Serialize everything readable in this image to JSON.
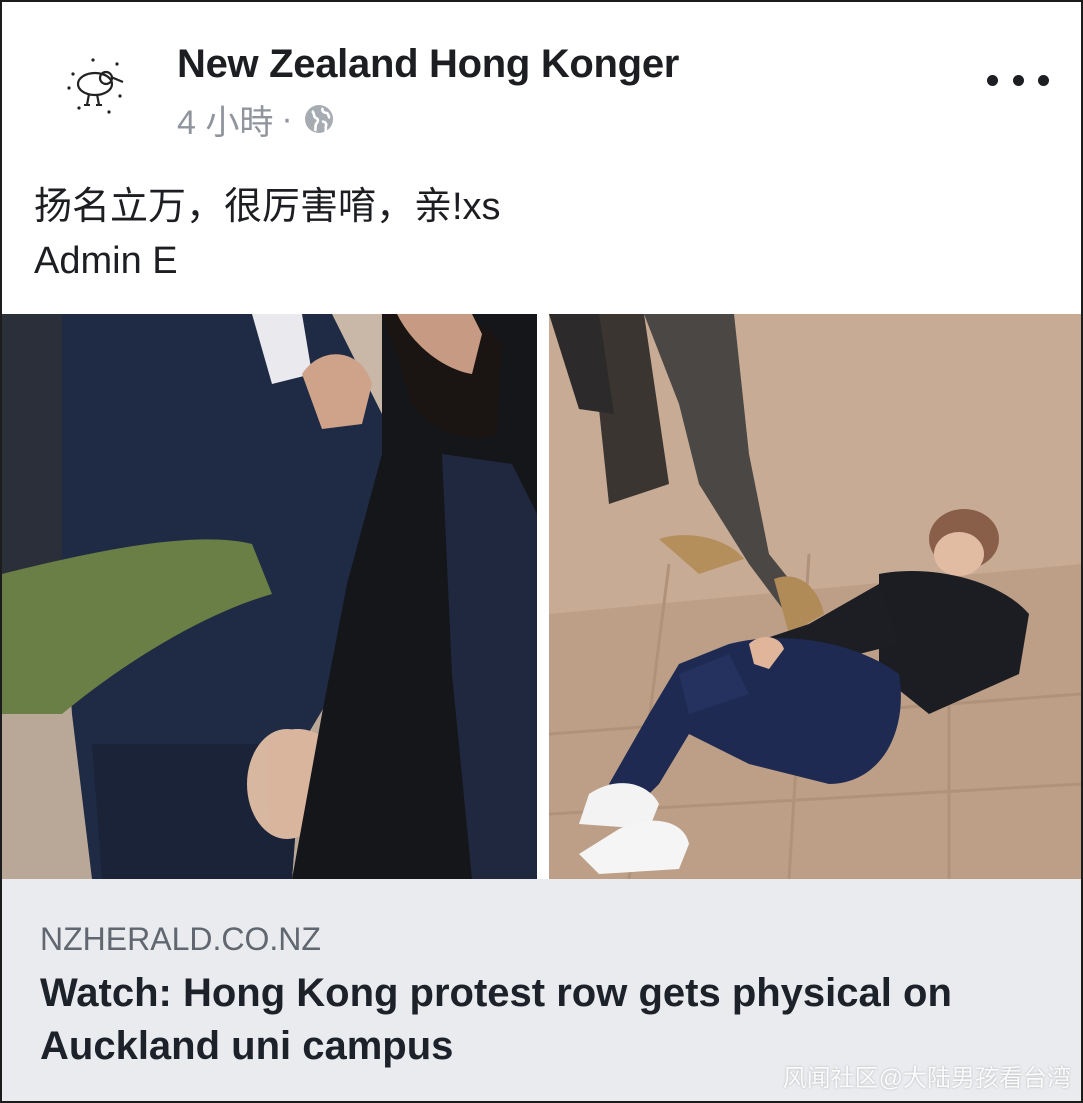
{
  "post": {
    "page_name": "New Zealand Hong Konger",
    "time": "4 小時",
    "separator": "·",
    "privacy_icon": "globe-icon",
    "more_icon": "more-options-icon",
    "avatar_icon": "kiwi-bird-icon",
    "text_line1": "扬名立万，很厉害唷，亲!xs",
    "text_line2": "Admin E"
  },
  "link_preview": {
    "domain": "NZHERALD.CO.NZ",
    "title": "Watch: Hong Kong protest row gets physical on Auckland uni campus"
  },
  "watermark": "风闻社区@大陆男孩看台湾",
  "colors": {
    "name": "#1c1e21",
    "meta": "#90949c",
    "card_bg": "#e9ebee",
    "domain": "#606770"
  }
}
